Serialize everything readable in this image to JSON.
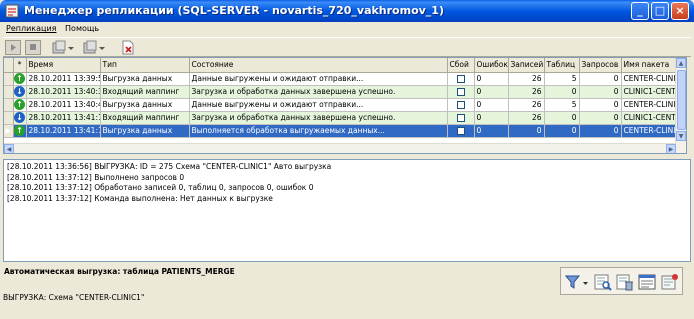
{
  "window": {
    "title": "Менеджер репликации (SQL-SERVER - novartis_720_vakhromov_1)",
    "minimize": "_",
    "maximize": "□",
    "close": "×"
  },
  "menu": [
    "Репликация",
    "Помощь"
  ],
  "grid": {
    "columns": [
      "*",
      "Время",
      "Тип",
      "Состояние",
      "Сбой",
      "Ошибок",
      "Записей",
      "Таблиц",
      "Запросов",
      "Имя пакета"
    ],
    "rows": [
      {
        "dir": "up",
        "time": "28.10.2011 13:39:55",
        "type": "Выгрузка данных",
        "state": "Данные выгружены и ожидают отправки...",
        "errors": "0",
        "records": "26",
        "tables": "5",
        "queries": "0",
        "package": "CENTER-CLINIC1",
        "style": "normal"
      },
      {
        "dir": "down",
        "time": "28.10.2011 13:40:32",
        "type": "Входящий маппинг",
        "state": "Загрузка и обработка данных завершена успешно.",
        "errors": "0",
        "records": "26",
        "tables": "0",
        "queries": "0",
        "package": "CLINIC1-CENTE",
        "style": "green"
      },
      {
        "dir": "up",
        "time": "28.10.2011 13:40:46",
        "type": "Выгрузка данных",
        "state": "Данные выгружены и ожидают отправки...",
        "errors": "0",
        "records": "26",
        "tables": "5",
        "queries": "0",
        "package": "CENTER-CLINIC1",
        "style": "normal"
      },
      {
        "dir": "down",
        "time": "28.10.2011 13:41:14",
        "type": "Входящий маппинг",
        "state": "Загрузка и обработка данных завершена успешно.",
        "errors": "0",
        "records": "26",
        "tables": "0",
        "queries": "0",
        "package": "CLINIC1-CENTE",
        "style": "green"
      },
      {
        "dir": "up",
        "time": "28.10.2011 13:41:19",
        "type": "Выгрузка данных",
        "state": "Выполняется обработка выгружаемых данных...",
        "errors": "0",
        "records": "0",
        "tables": "0",
        "queries": "0",
        "package": "CENTER-CLINIC1",
        "style": "sel"
      }
    ]
  },
  "log": [
    "[28.10.2011 13:36:56] ВЫГРУЗКА: ID = 275 Схема \"CENTER-CLINIC1\" Авто выгрузка",
    "[28.10.2011 13:37:12] Выполнено запросов 0",
    "[28.10.2011 13:37:12] Обработано записей 0, таблиц 0, запросов 0, ошибок 0",
    "[28.10.2011 13:37:12] Команда выполнена: Нет данных к выгрузке"
  ],
  "footer": {
    "auto_title": "Автоматическая выгрузка: таблица PATIENTS_MERGE",
    "status": "ВЫГРУЗКА: Схема \"CENTER-CLINIC1\""
  },
  "colors": {
    "selected": "#316ac5",
    "completed_row": "#e4f5dc",
    "titlebar": "#0058e0"
  }
}
